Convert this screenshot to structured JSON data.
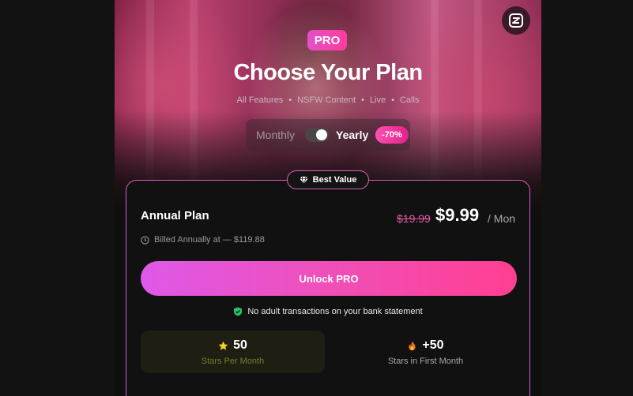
{
  "header": {
    "badge": "PRO",
    "title": "Choose Your Plan",
    "features": [
      "All Features",
      "NSFW Content",
      "Live",
      "Calls"
    ],
    "separator": "•"
  },
  "billing_toggle": {
    "monthly_label": "Monthly",
    "yearly_label": "Yearly",
    "selected": "Yearly",
    "discount_badge": "-70%"
  },
  "plan_card": {
    "badge": "Best Value",
    "name": "Annual Plan",
    "old_price": "$19.99",
    "price": "$9.99",
    "period": "/ Mon",
    "billing_note": "Billed Annually at — $119.88",
    "cta_label": "Unlock PRO",
    "privacy_note": "No adult transactions on your bank statement"
  },
  "perks": [
    {
      "value": "50",
      "label": "Stars Per Month",
      "icon": "star-icon"
    },
    {
      "value": "+50",
      "label": "Stars in First Month",
      "icon": "fire-icon"
    }
  ],
  "colors": {
    "accent_pink": "#ff3c9c",
    "accent_purple": "#de59e8",
    "card_border": "#d75fbf",
    "shield_green": "#27c26a"
  }
}
